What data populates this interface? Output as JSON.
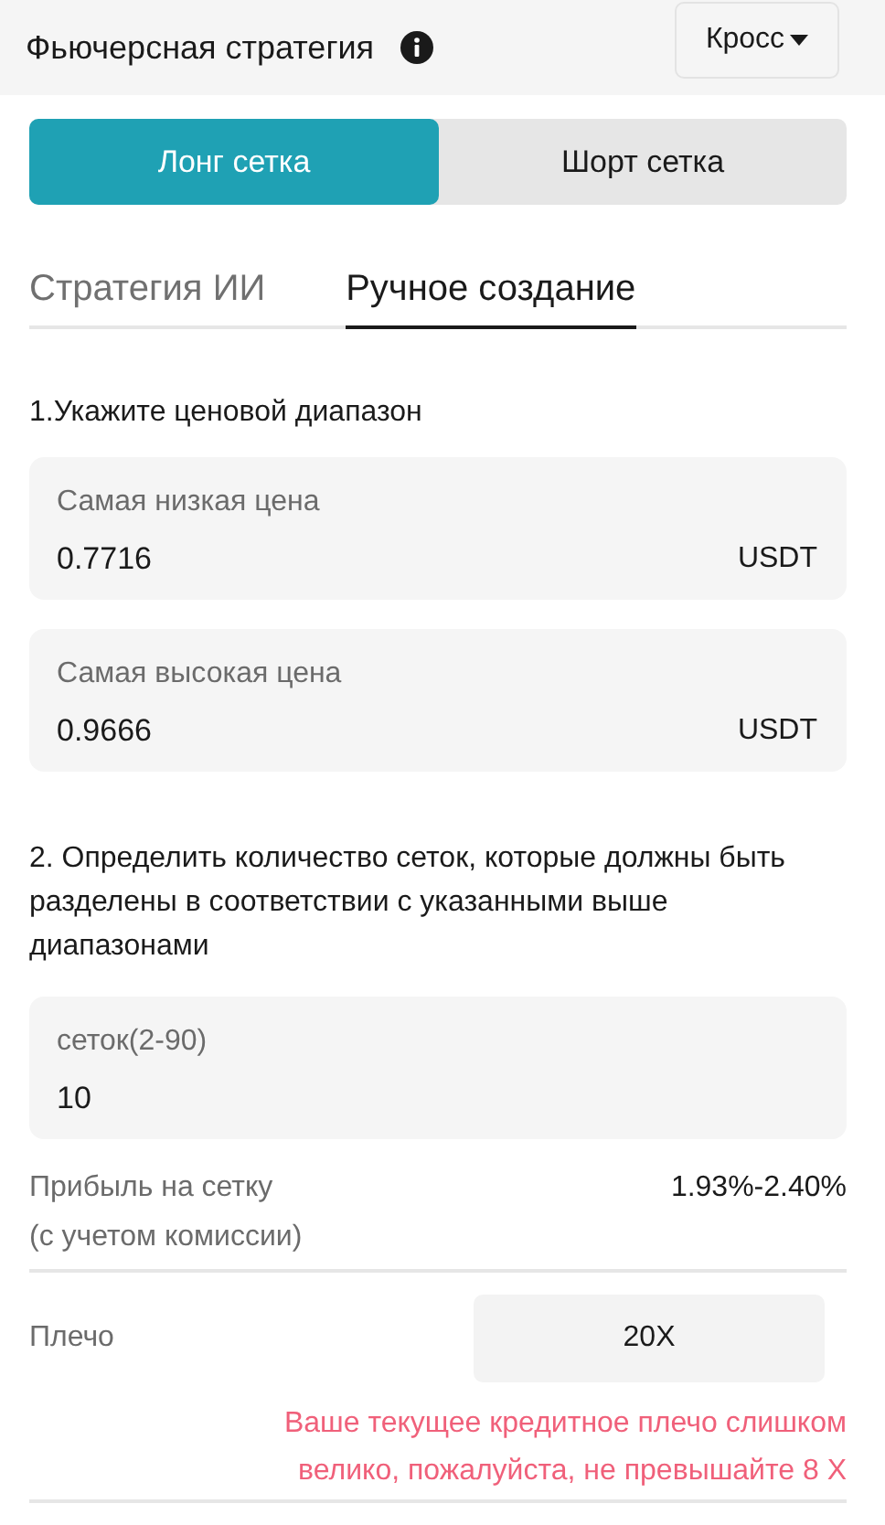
{
  "header": {
    "title": "Фьючерсная стратегия",
    "margin_mode": "Кросс"
  },
  "directions": [
    {
      "label": "Лонг сетка",
      "selected": true
    },
    {
      "label": "Шорт сетка",
      "selected": false
    }
  ],
  "tabs": [
    {
      "label": "Стратегия ИИ",
      "selected": false
    },
    {
      "label": "Ручное создание",
      "selected": true
    }
  ],
  "price_section": {
    "title": "1.Укажите ценовой диапазон",
    "fields": [
      {
        "label": "Самая низкая цена",
        "value": "0.7716",
        "unit": "USDT"
      },
      {
        "label": "Самая высокая цена",
        "value": "0.9666",
        "unit": "USDT"
      }
    ]
  },
  "grid_section": {
    "title": "2. Определить количество сеток, которые должны быть разделены в соответствии с указанными выше диапазонами",
    "field": {
      "label": "сеток(2-90)",
      "value": "10"
    }
  },
  "profit": {
    "label": "Прибыль на сетку",
    "sublabel": "(с учетом комиссии)",
    "value": "1.93%-2.40%"
  },
  "leverage": {
    "label": "Плечо",
    "value": "20X",
    "warning": "Ваше текущее кредитное плечо слишком велико, пожалуйста, не превышайте 8 X"
  }
}
